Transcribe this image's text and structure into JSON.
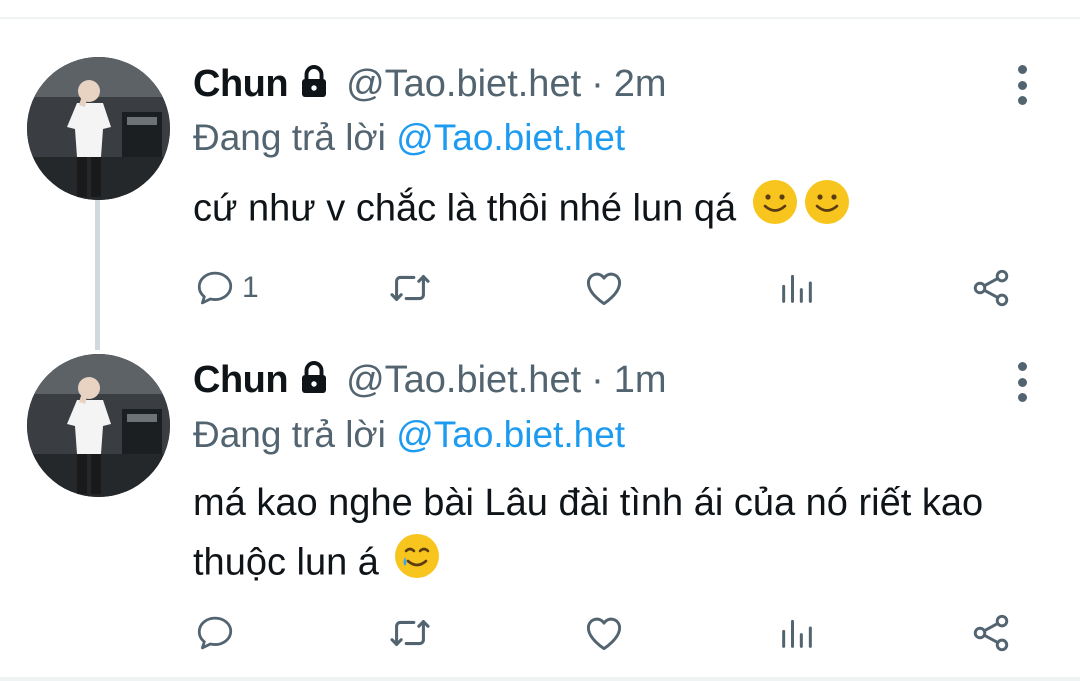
{
  "tweets": [
    {
      "name": "Chun",
      "handle": "@Tao.biet.het",
      "separator": "·",
      "time": "2m",
      "reply_prefix": "Đang trả lời",
      "reply_to": "@Tao.biet.het",
      "text": "cứ như v chắc là thôi nhé lun qá",
      "emoji": [
        "slightly-smiling-face",
        "slightly-smiling-face"
      ],
      "reply_count": "1"
    },
    {
      "name": "Chun",
      "handle": "@Tao.biet.het",
      "separator": "·",
      "time": "1m",
      "reply_prefix": "Đang trả lời",
      "reply_to": "@Tao.biet.het",
      "text": "má kao nghe bài Lâu đài tình ái của nó riết kao thuộc lun á",
      "emoji": [
        "smiling-face-with-tear"
      ],
      "reply_count": ""
    }
  ],
  "colors": {
    "text_primary": "#0f1419",
    "text_secondary": "#536471",
    "mention": "#1d9bf0",
    "thread_line": "#cfd9de",
    "divider": "#eff3f4",
    "emoji_yellow": "#f7c51d"
  },
  "icons": [
    "lock-icon",
    "more-options-icon",
    "reply-icon",
    "retweet-icon",
    "like-icon",
    "analytics-icon",
    "share-icon"
  ]
}
